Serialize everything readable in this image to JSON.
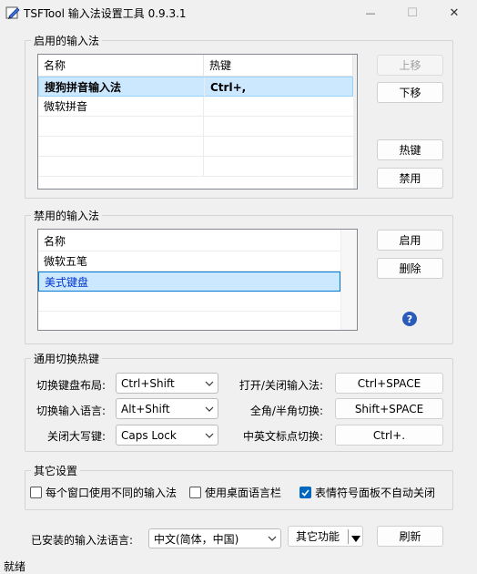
{
  "window": {
    "title": "TSFTool 输入法设置工具 0.9.3.1",
    "minimize_glyph": "—",
    "maximize_glyph": "☐",
    "close_glyph": "✕"
  },
  "enabled_group": {
    "label": "启用的输入法",
    "columns": [
      "名称",
      "热键"
    ],
    "rows": [
      {
        "name": "搜狗拼音输入法",
        "hotkey": "Ctrl+,"
      },
      {
        "name": "微软拼音",
        "hotkey": ""
      }
    ],
    "buttons": {
      "move_up": "上移",
      "move_down": "下移",
      "hotkey": "热键",
      "disable": "禁用"
    }
  },
  "disabled_group": {
    "label": "禁用的输入法",
    "column": "名称",
    "rows": [
      "微软五笔",
      "美式键盘"
    ],
    "buttons": {
      "enable": "启用",
      "delete": "删除"
    },
    "help_glyph": "?"
  },
  "hotkey_group": {
    "label": "通用切换热键",
    "switch_layout_label": "切换键盘布局:",
    "switch_layout_value": "Ctrl+Shift",
    "switch_lang_label": "切换输入语言:",
    "switch_lang_value": "Alt+Shift",
    "capslock_label": "关闭大写键:",
    "capslock_value": "Caps Lock",
    "toggle_ime_label": "打开/关闭输入法:",
    "toggle_ime_value": "Ctrl+SPACE",
    "fullhalf_label": "全角/半角切换:",
    "fullhalf_value": "Shift+SPACE",
    "punct_label": "中英文标点切换:",
    "punct_value": "Ctrl+."
  },
  "other_group": {
    "label": "其它设置",
    "options": [
      {
        "label": "每个窗口使用不同的输入法",
        "checked": false
      },
      {
        "label": "使用桌面语言栏",
        "checked": false
      },
      {
        "label": "表情符号面板不自动关闭",
        "checked": true
      }
    ]
  },
  "bottom": {
    "installed_lang_label": "已安装的输入法语言:",
    "installed_lang_value": "中文(简体，中国)",
    "other_features": "其它功能",
    "refresh": "刷新"
  },
  "status": {
    "text": "就绪"
  },
  "colors": {
    "accent": "#0067c0",
    "selection": "#cce8ff",
    "window_bg": "#f0f0f0"
  }
}
